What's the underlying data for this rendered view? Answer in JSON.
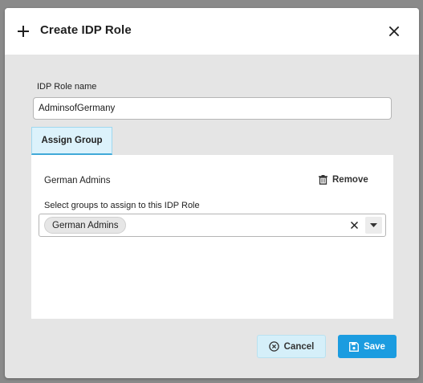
{
  "dialog": {
    "title": "Create IDP Role",
    "icons": {
      "header": "plus-icon",
      "close": "close-icon"
    }
  },
  "form": {
    "name_label": "IDP Role name",
    "name_value": "AdminsofGermany"
  },
  "tabs": [
    {
      "label": "Assign Group",
      "active": true
    }
  ],
  "group": {
    "name": "German Admins",
    "remove_label": "Remove",
    "remove_icon": "trash-icon",
    "select_label": "Select groups to assign to this IDP Role",
    "selected": [
      "German Admins"
    ],
    "icons": {
      "clear": "clear-icon",
      "dropdown": "caret-down-icon"
    }
  },
  "footer": {
    "cancel_label": "Cancel",
    "cancel_icon": "cancel-circle-icon",
    "save_label": "Save",
    "save_icon": "floppy-disk-icon"
  },
  "colors": {
    "primary": "#1b9ce0",
    "secondary_bg": "#d5eff9",
    "tab_active_bg": "#dcf2fb",
    "tab_border": "#41a9d8",
    "dialog_bg": "#e5e5e5",
    "overlay": "#8a8a8a"
  }
}
